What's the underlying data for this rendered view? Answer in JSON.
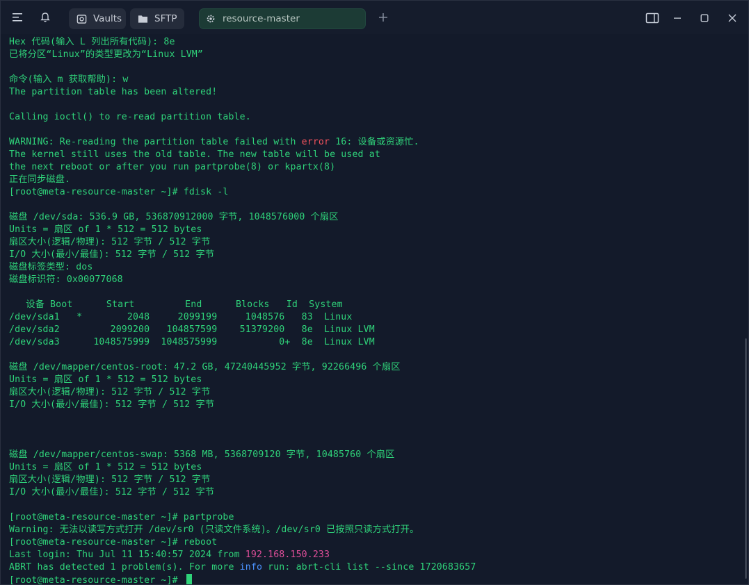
{
  "titlebar": {
    "tabs": [
      {
        "label": "Vaults",
        "icon": "vault-icon"
      },
      {
        "label": "SFTP",
        "icon": "folder-icon"
      },
      {
        "label": "resource-master",
        "icon": "terminal-icon"
      }
    ]
  },
  "colors": {
    "terminal_text": "#2fd37a",
    "error": "#f0515c",
    "info": "#4b93ff",
    "ip": "#e04f9a",
    "background": "#131a2a"
  },
  "terminal": {
    "lines": [
      [
        {
          "t": "Hex 代码(输入 L 列出所有代码): 8e"
        }
      ],
      [
        {
          "t": "已将分区“Linux”的类型更改为“Linux LVM”"
        }
      ],
      [
        {
          "t": ""
        }
      ],
      [
        {
          "t": "命令(输入 m 获取帮助): w"
        }
      ],
      [
        {
          "t": "The partition table has been altered!"
        }
      ],
      [
        {
          "t": ""
        }
      ],
      [
        {
          "t": "Calling ioctl() to re-read partition table."
        }
      ],
      [
        {
          "t": ""
        }
      ],
      [
        {
          "t": "WARNING: Re-reading the partition table failed with "
        },
        {
          "t": "error",
          "c": "err"
        },
        {
          "t": " 16: 设备或资源忙."
        }
      ],
      [
        {
          "t": "The kernel still uses the old table. The new table will be used at"
        }
      ],
      [
        {
          "t": "the next reboot or after you run partprobe(8) or kpartx(8)"
        }
      ],
      [
        {
          "t": "正在同步磁盘."
        }
      ],
      [
        {
          "t": "[root@meta-resource-master ~]# fdisk -l"
        }
      ],
      [
        {
          "t": ""
        }
      ],
      [
        {
          "t": "磁盘 /dev/sda: 536.9 GB, 536870912000 字节, 1048576000 个扇区"
        }
      ],
      [
        {
          "t": "Units = 扇区 of 1 * 512 = 512 bytes"
        }
      ],
      [
        {
          "t": "扇区大小(逻辑/物理): 512 字节 / 512 字节"
        }
      ],
      [
        {
          "t": "I/O 大小(最小/最佳): 512 字节 / 512 字节"
        }
      ],
      [
        {
          "t": "磁盘标签类型: dos"
        }
      ],
      [
        {
          "t": "磁盘标识符: 0x00077068"
        }
      ],
      [
        {
          "t": ""
        }
      ],
      [
        {
          "t": "   设备 Boot      Start         End      Blocks   Id  System"
        }
      ],
      [
        {
          "t": "/dev/sda1   *        2048     2099199     1048576   83  Linux"
        }
      ],
      [
        {
          "t": "/dev/sda2         2099200   104857599    51379200   8e  Linux LVM"
        }
      ],
      [
        {
          "t": "/dev/sda3      1048575999  1048575999           0+  8e  Linux LVM"
        }
      ],
      [
        {
          "t": ""
        }
      ],
      [
        {
          "t": "磁盘 /dev/mapper/centos-root: 47.2 GB, 47240445952 字节, 92266496 个扇区"
        }
      ],
      [
        {
          "t": "Units = 扇区 of 1 * 512 = 512 bytes"
        }
      ],
      [
        {
          "t": "扇区大小(逻辑/物理): 512 字节 / 512 字节"
        }
      ],
      [
        {
          "t": "I/O 大小(最小/最佳): 512 字节 / 512 字节"
        }
      ],
      [
        {
          "t": ""
        }
      ],
      [
        {
          "t": ""
        }
      ],
      [
        {
          "t": ""
        }
      ],
      [
        {
          "t": "磁盘 /dev/mapper/centos-swap: 5368 MB, 5368709120 字节, 10485760 个扇区"
        }
      ],
      [
        {
          "t": "Units = 扇区 of 1 * 512 = 512 bytes"
        }
      ],
      [
        {
          "t": "扇区大小(逻辑/物理): 512 字节 / 512 字节"
        }
      ],
      [
        {
          "t": "I/O 大小(最小/最佳): 512 字节 / 512 字节"
        }
      ],
      [
        {
          "t": ""
        }
      ],
      [
        {
          "t": "[root@meta-resource-master ~]# partprobe"
        }
      ],
      [
        {
          "t": "Warning: 无法以读写方式打开 /dev/sr0 (只读文件系统)。/dev/sr0 已按照只读方式打开。"
        }
      ],
      [
        {
          "t": "[root@meta-resource-master ~]# reboot"
        }
      ],
      [
        {
          "t": "Last login: Thu Jul 11 15:40:57 2024 from "
        },
        {
          "t": "192.168.150.233",
          "c": "ip"
        }
      ],
      [
        {
          "t": "ABRT has detected 1 problem(s). For more "
        },
        {
          "t": "info",
          "c": "info"
        },
        {
          "t": " run: abrt-cli list --since 1720683657"
        }
      ],
      [
        {
          "t": "[root@meta-resource-master ~]# "
        }
      ]
    ]
  }
}
